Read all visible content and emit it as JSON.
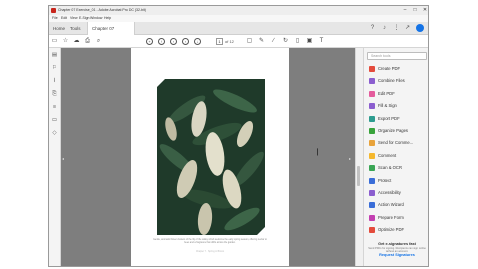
{
  "window": {
    "title": "Chapter 07 Exercise_01 - Adobe Acrobat Pro DC (32-bit)",
    "controls": [
      "–",
      "□",
      "✕"
    ]
  },
  "menu": [
    "File",
    "Edit",
    "View",
    "E-Sign",
    "Window",
    "Help"
  ],
  "tabs": {
    "home": "Home",
    "tools": "Tools",
    "document": "Chapter 07 Exercis...",
    "close": "✕"
  },
  "toolbar": {
    "page_current": "1",
    "page_count": "of 12"
  },
  "document": {
    "caption": "Gentle, aromatic flower clusters of the lily of the valley shrub welcome the early spring season, offering nectar to bees and a fragrance that drifts across the garden.",
    "footer": "Chapter 7 · Spring in Bloom"
  },
  "tools_pane": {
    "search_placeholder": "Search tools",
    "items": [
      {
        "label": "Create PDF",
        "color": "#e44b3c"
      },
      {
        "label": "Combine Files",
        "color": "#8b5ecf"
      },
      {
        "label": "Edit PDF",
        "color": "#e45b9c"
      },
      {
        "label": "Fill & Sign",
        "color": "#8b5ecf"
      },
      {
        "label": "Export PDF",
        "color": "#2d9c8f"
      },
      {
        "label": "Organize Pages",
        "color": "#39a33b"
      },
      {
        "label": "Send for Comme...",
        "color": "#e8a33b"
      },
      {
        "label": "Comment",
        "color": "#f5b82e"
      },
      {
        "label": "Scan & OCR",
        "color": "#3aa655"
      },
      {
        "label": "Protect",
        "color": "#3a6dd8"
      },
      {
        "label": "Accessibility",
        "color": "#8b5ecf"
      },
      {
        "label": "Action Wizard",
        "color": "#3a6dd8"
      },
      {
        "label": "Prepare Form",
        "color": "#c33fb1"
      },
      {
        "label": "Optimize PDF",
        "color": "#e44b3c"
      }
    ],
    "promo": {
      "heading": "Get e-signatures fast",
      "sub": "Send PDFs for signing. Recipients can sign online without an account.",
      "link": "Request Signatures"
    }
  },
  "colors": {
    "accent": "#1473e6",
    "app_red": "#c8261c",
    "doc_bg": "#7e7e7e"
  }
}
